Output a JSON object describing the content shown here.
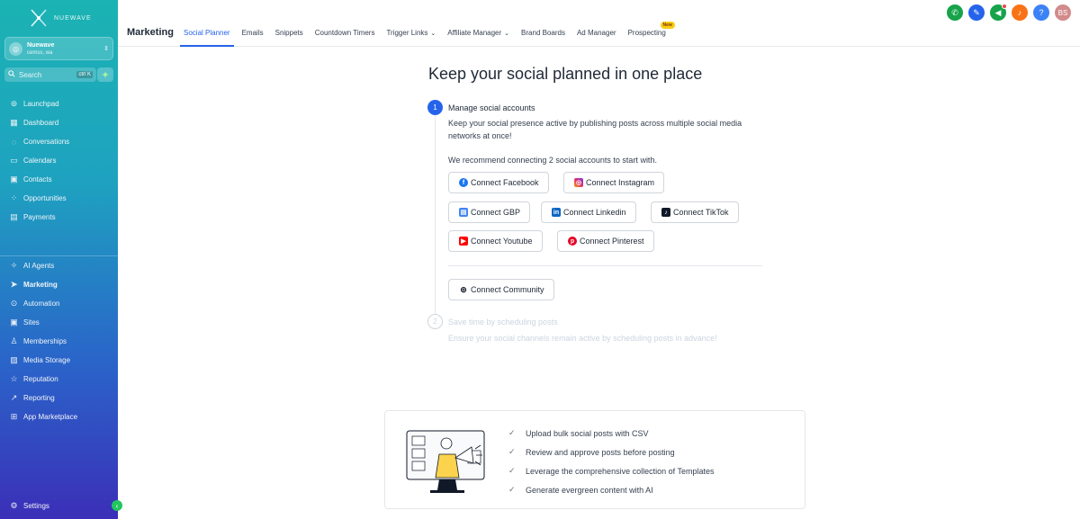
{
  "sidebar": {
    "brand": "NUEWAVE",
    "account": {
      "name": "Nuewave",
      "location": "cemss, wa"
    },
    "search": {
      "placeholder": "Search",
      "shortcut": "ctrl K"
    },
    "nav_top": [
      {
        "label": "Launchpad",
        "icon": "rocket-icon"
      },
      {
        "label": "Dashboard",
        "icon": "grid-icon"
      },
      {
        "label": "Conversations",
        "icon": "chat-icon"
      },
      {
        "label": "Calendars",
        "icon": "calendar-icon"
      },
      {
        "label": "Contacts",
        "icon": "contact-icon"
      },
      {
        "label": "Opportunities",
        "icon": "opportunities-icon"
      },
      {
        "label": "Payments",
        "icon": "payments-icon"
      }
    ],
    "nav_bottom": [
      {
        "label": "AI Agents",
        "icon": "sparkle-icon"
      },
      {
        "label": "Marketing",
        "icon": "send-icon"
      },
      {
        "label": "Automation",
        "icon": "automation-icon"
      },
      {
        "label": "Sites",
        "icon": "sites-icon"
      },
      {
        "label": "Memberships",
        "icon": "membership-icon"
      },
      {
        "label": "Media Storage",
        "icon": "media-icon"
      },
      {
        "label": "Reputation",
        "icon": "star-icon"
      },
      {
        "label": "Reporting",
        "icon": "chart-icon"
      },
      {
        "label": "App Marketplace",
        "icon": "apps-icon"
      }
    ],
    "settings": "Settings"
  },
  "header": {
    "title": "Marketing",
    "tabs": [
      {
        "label": "Social Planner"
      },
      {
        "label": "Emails"
      },
      {
        "label": "Snippets"
      },
      {
        "label": "Countdown Timers"
      },
      {
        "label": "Trigger Links"
      },
      {
        "label": "Affiliate Manager"
      },
      {
        "label": "Brand Boards"
      },
      {
        "label": "Ad Manager"
      },
      {
        "label": "Prospecting"
      }
    ],
    "new_badge": "New",
    "avatar_initials": "BS",
    "icon_colors": {
      "phone": "#16a34a",
      "magic": "#2563eb",
      "megaphone": "#16a34a",
      "bell": "#f97316",
      "help": "#3b82f6",
      "avatar": "#d28a8a"
    }
  },
  "main": {
    "heading": "Keep your social planned in one place",
    "step1": {
      "number": "1",
      "title": "Manage social accounts",
      "description": "Keep your social presence active by publishing posts across multiple social media networks at once!",
      "recommend": "We recommend connecting 2 social accounts to start with."
    },
    "buttons": {
      "facebook": "Connect Facebook",
      "instagram": "Connect Instagram",
      "gbp": "Connect GBP",
      "linkedin": "Connect Linkedin",
      "tiktok": "Connect TikTok",
      "youtube": "Connect Youtube",
      "pinterest": "Connect Pinterest",
      "community": "Connect Community"
    },
    "step2": {
      "number": "2",
      "title": "Save time by scheduling posts",
      "description": "Ensure your social channels remain active by scheduling posts in advance!"
    },
    "features": [
      "Upload bulk social posts with CSV",
      "Review and approve posts before posting",
      "Leverage the comprehensive collection of Templates",
      "Generate evergreen content with AI"
    ]
  }
}
